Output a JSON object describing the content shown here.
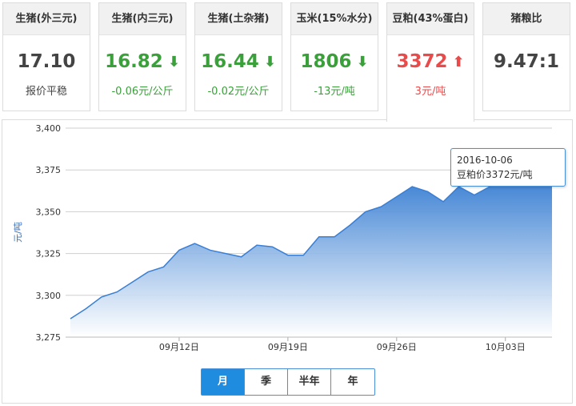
{
  "cards": [
    {
      "title": "生猪(外三元)",
      "value": "17.10",
      "change": "报价平稳",
      "trend": "flat",
      "arrow": ""
    },
    {
      "title": "生猪(内三元)",
      "value": "16.82",
      "change": "-0.06元/公斤",
      "trend": "down",
      "arrow": "🡣"
    },
    {
      "title": "生猪(土杂猪)",
      "value": "16.44",
      "change": "-0.02元/公斤",
      "trend": "down",
      "arrow": "🡣"
    },
    {
      "title": "玉米(15%水分)",
      "value": "1806",
      "change": "-13元/吨",
      "trend": "down",
      "arrow": "🡣"
    },
    {
      "title": "豆粕(43%蛋白)",
      "value": "3372",
      "change": "3元/吨",
      "trend": "up",
      "arrow": "🡡"
    },
    {
      "title": "猪粮比",
      "value": "9.47:1",
      "change": "",
      "trend": "flat",
      "arrow": ""
    }
  ],
  "active_card_index": 4,
  "colors": {
    "up": "#e94b4b",
    "down": "#3aa03a",
    "accent": "#1f8ce0",
    "line": "#3a7fd4"
  },
  "tooltip": {
    "date": "2016-10-06",
    "text": "豆粕价3372元/吨"
  },
  "range_buttons": [
    "月",
    "季",
    "半年",
    "年"
  ],
  "range_selected": "月",
  "chart_data": {
    "type": "area",
    "ylabel": "元/吨",
    "ylim": [
      3275,
      3400
    ],
    "yticks": [
      "3,400",
      "3,375",
      "3,350",
      "3,325",
      "3,300",
      "3,275"
    ],
    "yticks_values": [
      3400,
      3375,
      3350,
      3325,
      3300,
      3275
    ],
    "xticks": [
      "09月12日",
      "09月19日",
      "09月26日",
      "10月03日"
    ],
    "xticks_day_index": [
      7,
      14,
      21,
      28
    ],
    "grid": true,
    "series": [
      {
        "x": [
          "09-05",
          "09-06",
          "09-07",
          "09-08",
          "09-09",
          "09-10",
          "09-11",
          "09-12",
          "09-13",
          "09-14",
          "09-15",
          "09-16",
          "09-17",
          "09-18",
          "09-19",
          "09-20",
          "09-21",
          "09-22",
          "09-23",
          "09-24",
          "09-25",
          "09-26",
          "09-27",
          "09-28",
          "09-29",
          "09-30",
          "10-01",
          "10-02",
          "10-03",
          "10-04",
          "10-05",
          "10-06"
        ],
        "values": [
          3286,
          3292,
          3299,
          3302,
          3308,
          3314,
          3317,
          3327,
          3331,
          3327,
          3325,
          3323,
          3330,
          3329,
          3324,
          3324,
          3335,
          3335,
          3342,
          3350,
          3353,
          3359,
          3365,
          3362,
          3356,
          3365,
          3360,
          3365,
          3368,
          3368,
          3370,
          3372
        ]
      }
    ]
  }
}
